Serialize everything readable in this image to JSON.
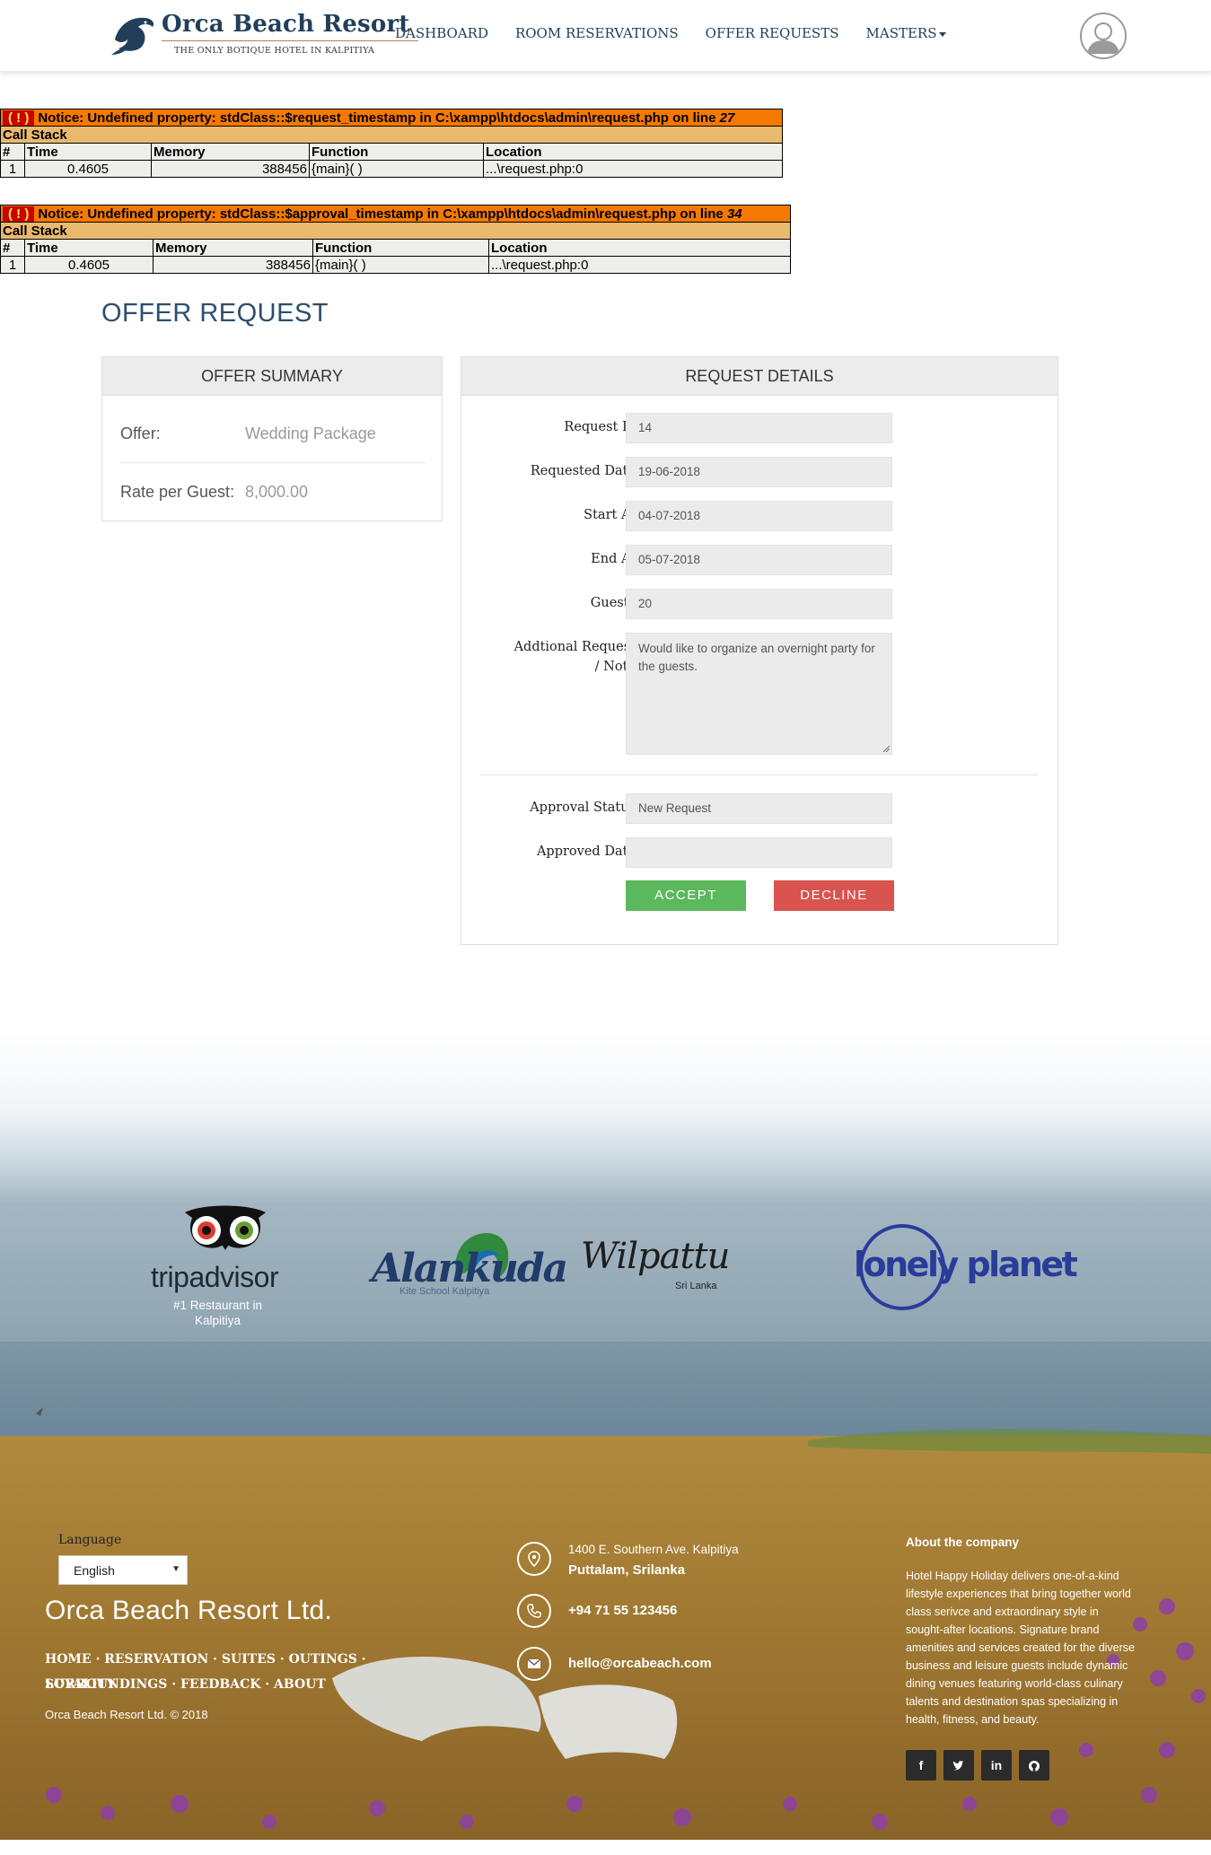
{
  "header": {
    "brand_title": "Orca Beach Resort",
    "brand_tagline": "THE ONLY BOTIQUE HOTEL IN KALPITIYA",
    "nav": [
      "DASHBOARD",
      "ROOM RESERVATIONS",
      "OFFER REQUESTS",
      "MASTERS"
    ]
  },
  "notices": [
    {
      "warn": "( ! )",
      "message": "Notice: Undefined property: stdClass::$request_timestamp in C:\\xampp\\htdocs\\admin\\request.php on line ",
      "line": "27",
      "call_stack": "Call Stack",
      "columns": [
        "#",
        "Time",
        "Memory",
        "Function",
        "Location"
      ],
      "row": [
        "1",
        "0.4605",
        "388456",
        "{main}( )",
        "...\\request.php:0"
      ]
    },
    {
      "warn": "( ! )",
      "message": "Notice: Undefined property: stdClass::$approval_timestamp in C:\\xampp\\htdocs\\admin\\request.php on line ",
      "line": "34",
      "call_stack": "Call Stack",
      "columns": [
        "#",
        "Time",
        "Memory",
        "Function",
        "Location"
      ],
      "row": [
        "1",
        "0.4605",
        "388456",
        "{main}( )",
        "...\\request.php:0"
      ]
    }
  ],
  "page_title": "OFFER REQUEST",
  "summary": {
    "heading": "OFFER SUMMARY",
    "offer_label": "Offer:",
    "offer_value": "Wedding Package",
    "rate_label": "Rate per Guest:",
    "rate_value": "8,000.00"
  },
  "details": {
    "heading": "REQUEST DETAILS",
    "request_id_label": "Request Id",
    "request_id": "14",
    "requested_date_label": "Requested Date",
    "requested_date": "19-06-2018",
    "start_label": "Start At",
    "start": "04-07-2018",
    "end_label": "End At",
    "end": "05-07-2018",
    "guests_label": "Guests",
    "guests": "20",
    "note_label_1": "Addtional Request",
    "note_label_2": "/ Note",
    "note": "Would like to organize an overnight party for the guests.",
    "approval_status_label": "Approval Status",
    "approval_status": "New Request",
    "approved_date_label": "Approved Date",
    "approved_date": "",
    "accept": "ACCEPT",
    "decline": "DECLINE"
  },
  "partners": {
    "tripadvisor": "tripadvisor",
    "tripadvisor_note": "#1 Restaurant in Kalpitiya",
    "alankuda": "Alankuda",
    "alankuda_sub": "Kite School Kalpitiya",
    "wilpattu": "Wilpattu",
    "wilpattu_sub": "Sri Lanka",
    "lonely_planet": "lonely planet"
  },
  "footer": {
    "language_label": "Language",
    "language_value": "English",
    "company_name": "Orca Beach Resort Ltd.",
    "links_line1": [
      "HOME",
      "RESERVATION",
      "SUITES",
      "OUTINGS",
      "LOYALITY"
    ],
    "links_line2": [
      "SURROUNDINGS",
      "FEEDBACK",
      "ABOUT"
    ],
    "copyright": "Orca Beach Resort Ltd. © 2018",
    "address_line1": "1400 E. Southern Ave. Kalpitiya",
    "address_line2": "Puttalam, Srilanka",
    "phone": "+94 71 55 123456",
    "email": "hello@orcabeach.com",
    "about_title": "About the company",
    "about_text": "Hotel Happy Holiday delivers one-of-a-kind lifestyle experiences that bring together world class serivce and extraordinary style in sought-after locations. Signature brand amenities and services created for the diverse business and leisure guests include dynamic dining venues featuring world-class culinary talents and destination spas specializing in health, fitness, and beauty.",
    "social": [
      "facebook-icon",
      "twitter-icon",
      "linkedin-icon",
      "github-icon"
    ]
  }
}
